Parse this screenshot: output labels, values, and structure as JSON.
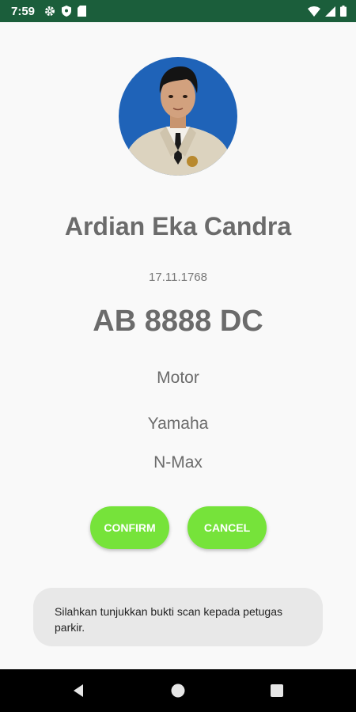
{
  "status_bar": {
    "time": "7:59",
    "left_icons": [
      "gear-icon",
      "shield-icon",
      "sd-card-icon"
    ],
    "right_icons": [
      "wifi-icon",
      "signal-icon",
      "battery-icon"
    ],
    "color": "#1b5e3b"
  },
  "profile": {
    "name": "Ardian Eka Candra",
    "id_number": "17.11.1768"
  },
  "vehicle": {
    "plate": "AB 8888 DC",
    "type": "Motor",
    "brand": "Yamaha",
    "model": "N-Max"
  },
  "actions": {
    "confirm_label": "CONFIRM",
    "cancel_label": "CANCEL",
    "button_color": "#76e33a"
  },
  "toast": {
    "message": "Silahkan tunjukkan bukti scan kepada petugas parkir."
  },
  "nav_bar": {
    "icons": [
      "back-icon",
      "home-icon",
      "recents-icon"
    ]
  }
}
